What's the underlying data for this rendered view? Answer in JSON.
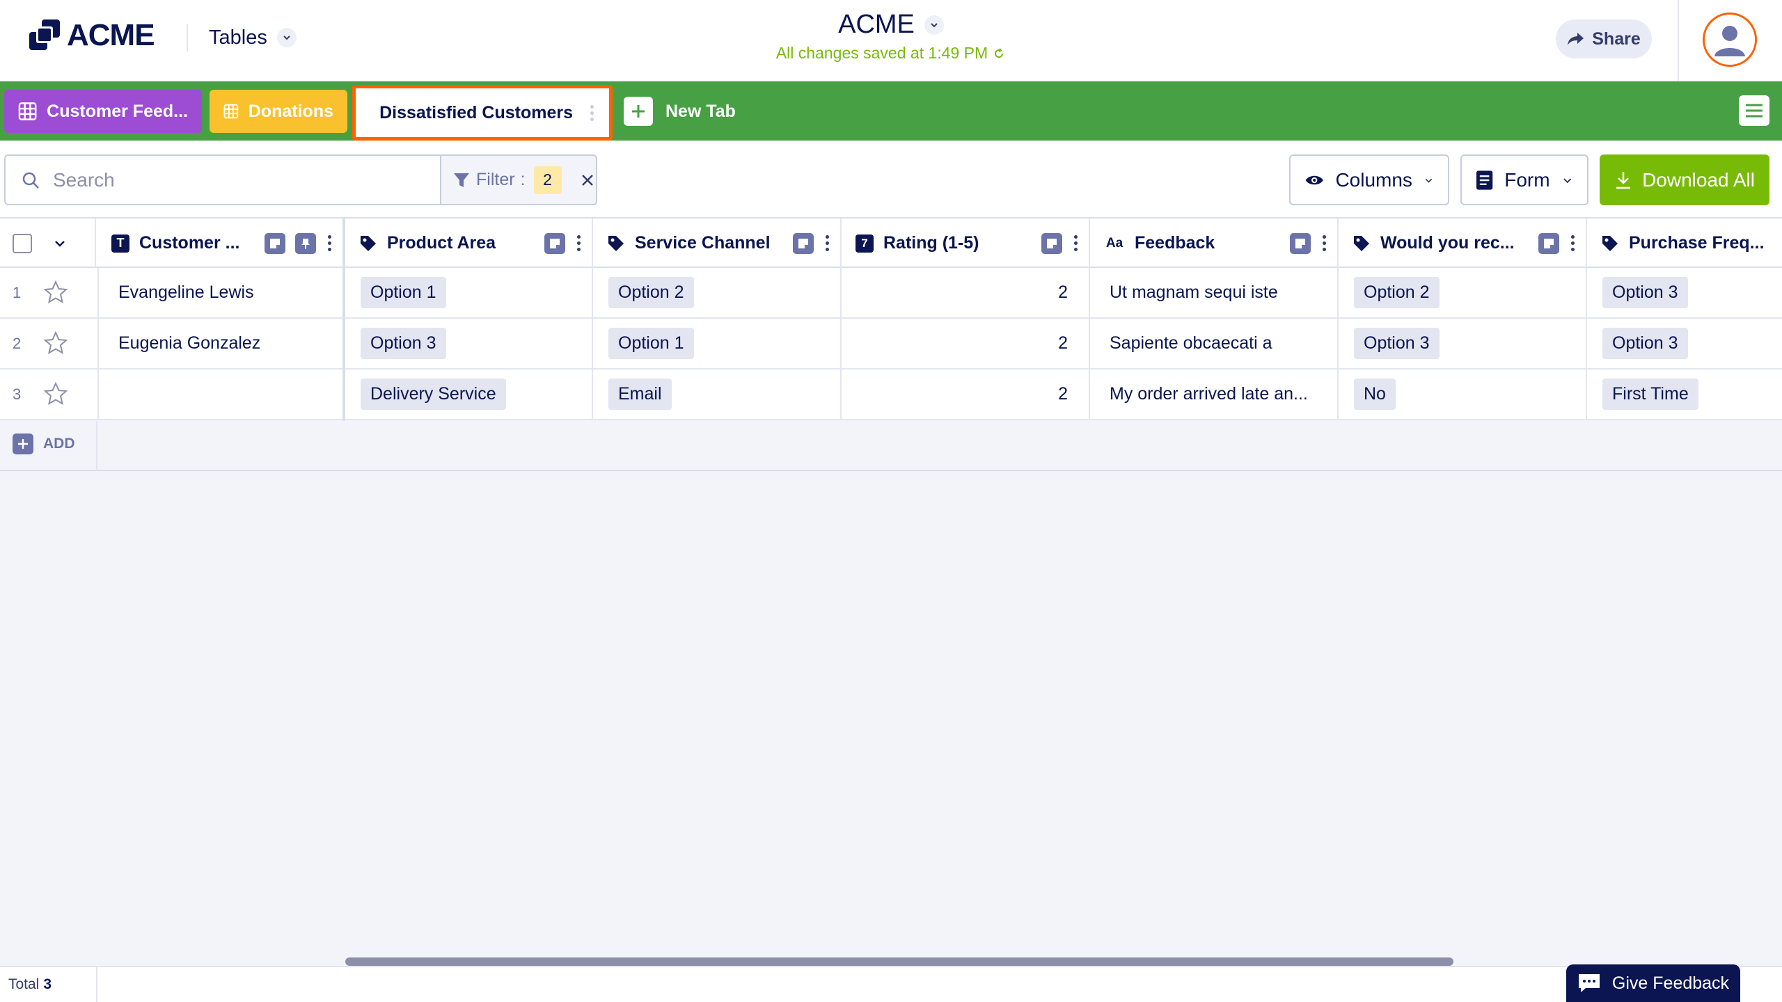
{
  "header": {
    "logo_text": "ACME",
    "tables_label": "Tables",
    "app_title": "ACME",
    "save_status": "All changes saved at 1:49 PM",
    "share_label": "Share"
  },
  "tabs": [
    {
      "label": "Customer Feed...",
      "color": "#9c4dd3"
    },
    {
      "label": "Donations",
      "color": "#f9c12d"
    },
    {
      "label": "Dissatisfied Customers",
      "active": true
    }
  ],
  "new_tab_label": "New Tab",
  "toolbar": {
    "search_placeholder": "Search",
    "filter_label": "Filter",
    "filter_separator": ":",
    "filter_count": "2",
    "columns_label": "Columns",
    "form_label": "Form",
    "download_label": "Download All"
  },
  "columns": [
    {
      "label": "Customer ...",
      "icon": "text-type-icon"
    },
    {
      "label": "Product Area",
      "icon": "tag-icon"
    },
    {
      "label": "Service Channel",
      "icon": "tag-icon"
    },
    {
      "label": "Rating (1-5)",
      "icon": "number-type-icon",
      "icon_text": "7"
    },
    {
      "label": "Feedback",
      "icon": "long-text-icon",
      "icon_text": "Aa"
    },
    {
      "label": "Would you rec...",
      "icon": "tag-icon"
    },
    {
      "label": "Purchase Freq...",
      "icon": "tag-icon"
    }
  ],
  "rows": [
    {
      "num": "1",
      "customer": "Evangeline Lewis",
      "product_area": "Option 1",
      "service_channel": "Option 2",
      "rating": "2",
      "feedback": "Ut magnam sequi iste",
      "recommend": "Option 2",
      "purchase": "Option 3"
    },
    {
      "num": "2",
      "customer": "Eugenia Gonzalez",
      "product_area": "Option 3",
      "service_channel": "Option 1",
      "rating": "2",
      "feedback": "Sapiente obcaecati a",
      "recommend": "Option 3",
      "purchase": "Option 3"
    },
    {
      "num": "3",
      "customer": "",
      "product_area": "Delivery Service",
      "service_channel": "Email",
      "rating": "2",
      "feedback": "My order arrived late an...",
      "recommend": "No",
      "purchase": "First Time"
    }
  ],
  "add_label": "ADD",
  "footer": {
    "total_label": "Total",
    "total_count": "3",
    "give_feedback_label": "Give Feedback"
  },
  "colors": {
    "tab_bar": "#47a043",
    "active_tab_border": "#ff6100",
    "download_button": "#78bb07",
    "brand_navy": "#0a1551",
    "save_status": "#78bb07"
  }
}
